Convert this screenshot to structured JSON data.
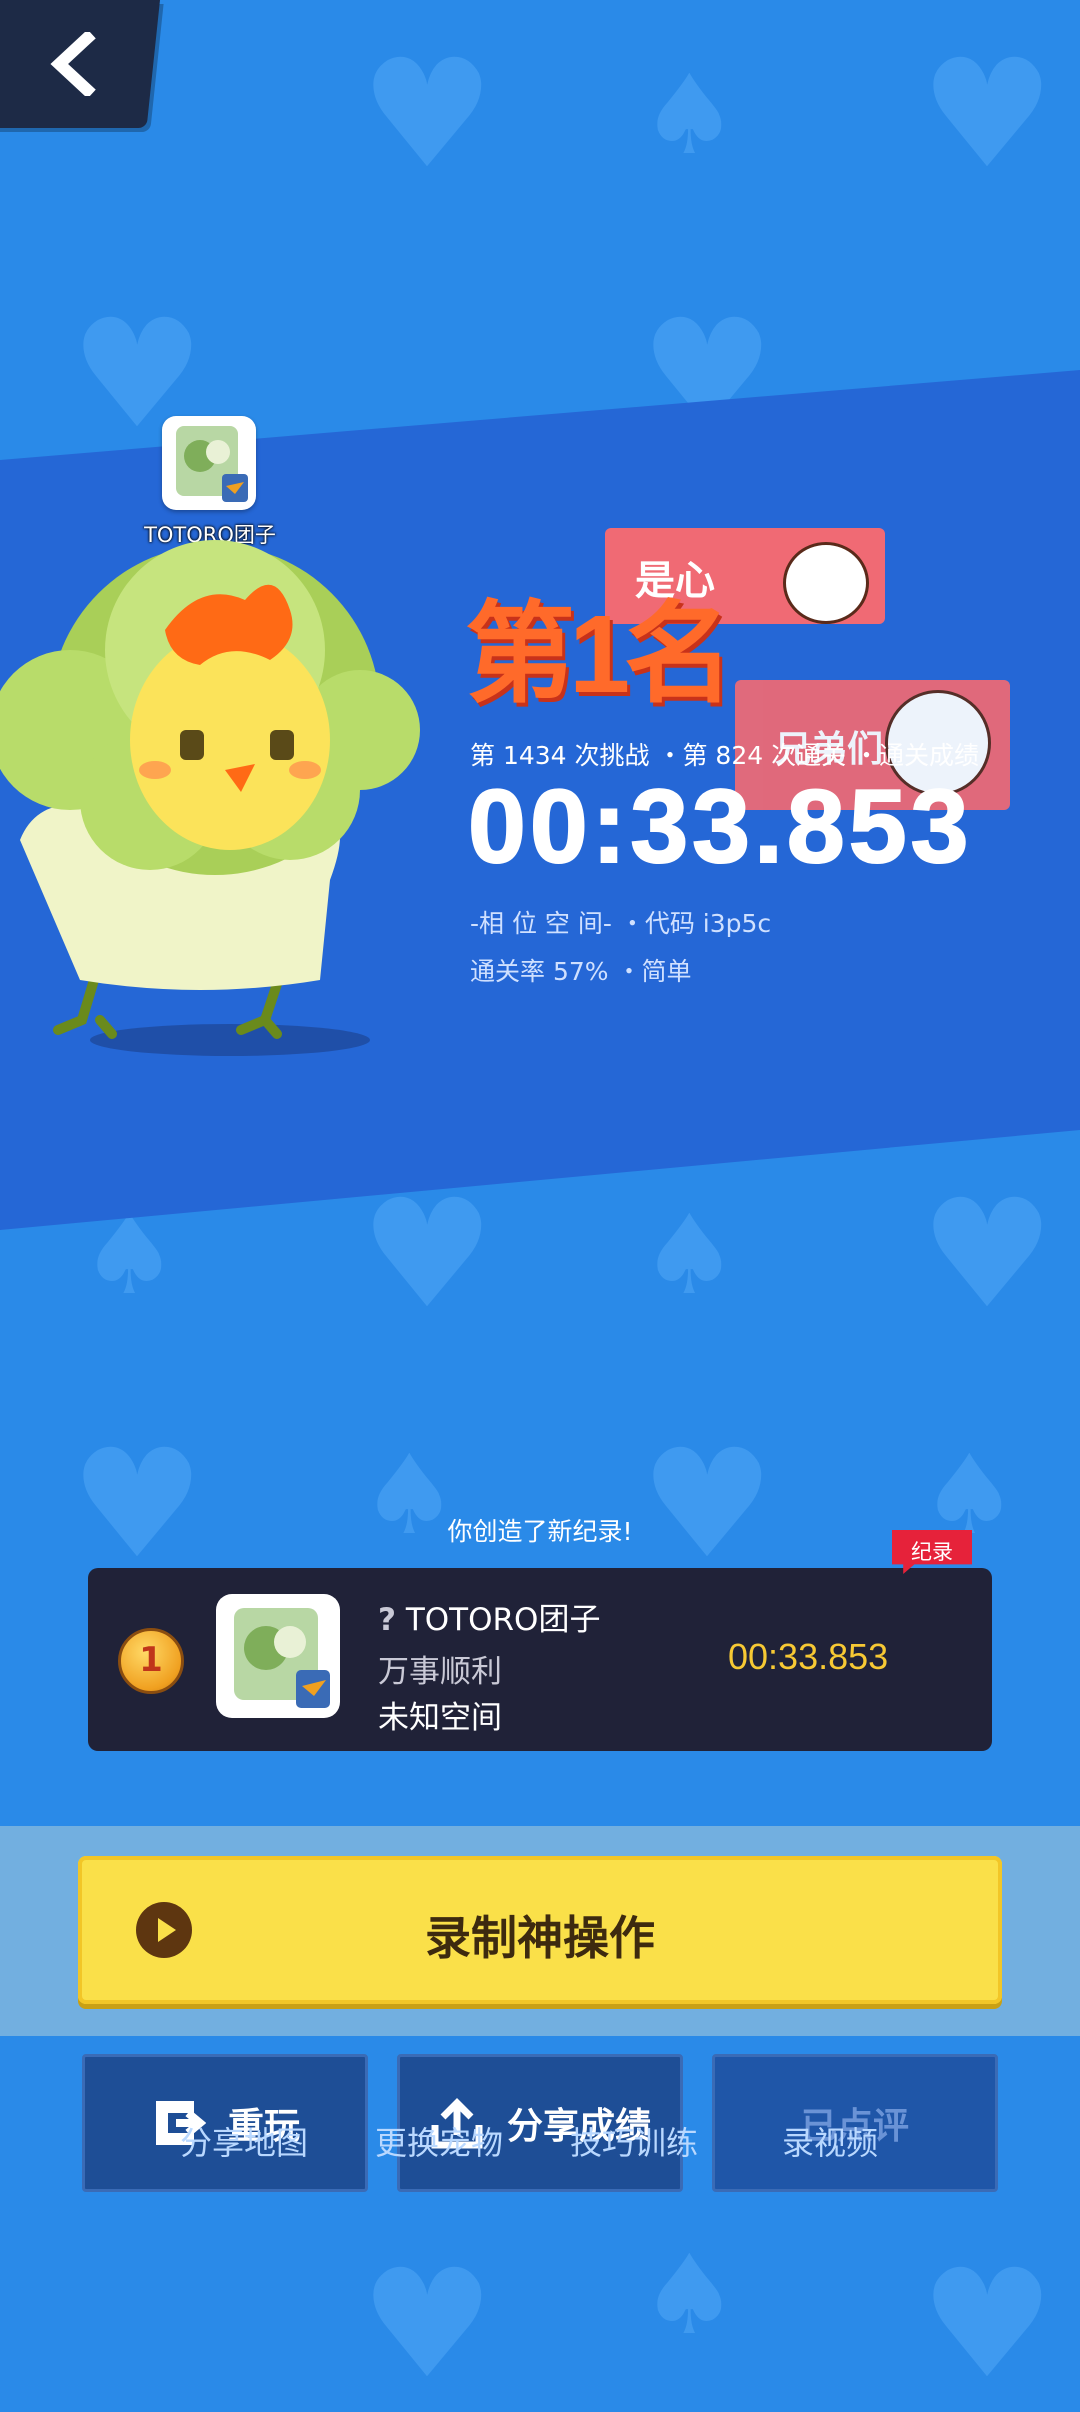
{
  "player": {
    "name_tag": "TOTORO团子",
    "subtitle_tag": "万事顺利"
  },
  "result": {
    "stats_line": "第 1434 次挑战 ・第 824 次通关 ・通关成绩",
    "time": "00:33.853",
    "meta_line1": "-相 位 空 间- ・代码 i3p5c",
    "meta_line2": "通关率 57% ・简单"
  },
  "overlay": {
    "banner": "第1名",
    "sticker1_text": "是心",
    "sticker2_text": "兄弟们"
  },
  "record": {
    "message": "你创造了新纪录!",
    "badge": "纪录",
    "rank": "1",
    "name": "TOTORO团子",
    "sub1": "万事顺利",
    "sub2": "未知空间",
    "time": "00:33.853"
  },
  "buttons": {
    "record_label": "录制神操作",
    "replay_label": "重玩",
    "share_label": "分享成绩",
    "rated_label": "已点评"
  },
  "links": {
    "share_map": "分享地图",
    "change_pet": "更换宠物",
    "skill_training": "技巧训练",
    "record_video": "录视频"
  },
  "colors": {
    "background": "#2a8ae8",
    "band": "#2567d6",
    "accent_yellow": "#fae049",
    "card_bg": "#202238",
    "record_badge": "#e6223a"
  },
  "icons": {
    "back": "chevron-left-icon",
    "play": "play-icon",
    "replay": "replay-icon",
    "share": "share-upload-icon",
    "medal": "gold-medal-icon"
  }
}
